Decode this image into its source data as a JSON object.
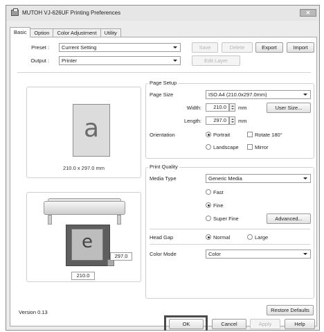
{
  "window": {
    "title": "MUTOH VJ-626UF Printing Preferences",
    "close_label": "✕"
  },
  "tabs": [
    {
      "label": "Basic",
      "active": true
    },
    {
      "label": "Option",
      "active": false
    },
    {
      "label": "Color Adjustment",
      "active": false
    },
    {
      "label": "Utility",
      "active": false
    }
  ],
  "preset": {
    "label": "Preset :",
    "value": "Current Setting",
    "save_label": "Save",
    "delete_label": "Delete",
    "export_label": "Export",
    "import_label": "Import"
  },
  "output": {
    "label": "Output :",
    "value": "Printer",
    "edit_layer_label": "Edit Layer"
  },
  "preview": {
    "paper_letter": "a",
    "page_size_text": "210.0 x 297.0 mm",
    "printer_letter": "e",
    "height_value": "297.0",
    "width_value": "210.0"
  },
  "page_setup": {
    "group_label": "Page Setup",
    "page_size_label": "Page Size",
    "page_size_value": "ISO A4 (210.0x297.0mm)",
    "width_label": "Width:",
    "width_value": "210.0",
    "width_unit": "mm",
    "length_label": "Length:",
    "length_value": "297.0",
    "length_unit": "mm",
    "user_size_label": "User Size...",
    "orientation_label": "Orientation",
    "portrait_label": "Portrait",
    "landscape_label": "Landscape",
    "rotate_label": "Rotate 180°",
    "mirror_label": "Mirror"
  },
  "print_quality": {
    "group_label": "Print Quality",
    "media_type_label": "Media Type",
    "media_type_value": "Generic Media",
    "fast_label": "Fast",
    "fine_label": "Fine",
    "super_fine_label": "Super Fine",
    "advanced_label": "Advanced...",
    "head_gap_label": "Head Gap",
    "normal_label": "Normal",
    "large_label": "Large",
    "color_mode_label": "Color Mode",
    "color_mode_value": "Color"
  },
  "footer": {
    "version_text": "Version 0.13",
    "restore_defaults_label": "Restore Defaults",
    "ok_label": "OK",
    "cancel_label": "Cancel",
    "apply_label": "Apply",
    "help_label": "Help"
  },
  "colors": {
    "highlight_frame": "#4a4a4a",
    "panel_bg": "#ffffff",
    "dialog_bg": "#ececec"
  },
  "icons": [
    "printer-app-icon",
    "close-icon",
    "dropdown-arrow-icon",
    "spin-up-icon",
    "spin-down-icon"
  ]
}
